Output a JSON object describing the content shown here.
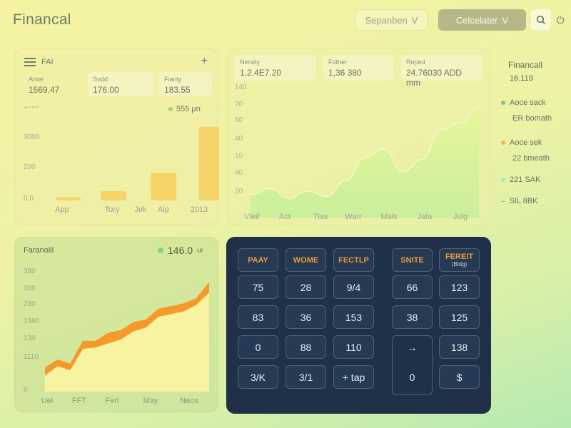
{
  "header": {
    "app_title": "Financal",
    "month_select": "Sepanben",
    "calculator_button": "Celcelater",
    "chevron": "V"
  },
  "left_card": {
    "title": "FAI",
    "add_symbol": "+",
    "stats": [
      {
        "label": "Anoe",
        "value": "1569,47"
      },
      {
        "label": "Sodd",
        "value": "176.00"
      },
      {
        "label": "Fianty",
        "value": "183.55"
      }
    ],
    "legend_value": "555 µn",
    "y_ticks": [
      "1000",
      "3000",
      "200",
      "0.0"
    ],
    "x_ticks": [
      "App",
      "Tory",
      "Jek",
      "Aip",
      "2013"
    ]
  },
  "middle_card": {
    "stats": [
      {
        "label": "Nersity",
        "value": "1.2.4E7.20"
      },
      {
        "label": "Fother",
        "value": "1,36 380"
      },
      {
        "label": "Reped",
        "value": "24.76030 ADD mm"
      }
    ],
    "y_ticks": [
      "140",
      "70",
      "50",
      "40",
      "10",
      "40",
      "20"
    ],
    "x_ticks": [
      "Vleif",
      "Act",
      "Tlas",
      "Warr",
      "Mais",
      "Jala",
      "Julg"
    ]
  },
  "side_panel": {
    "title": "Financall",
    "value": "16.119",
    "items": [
      {
        "label": "Aoce sack",
        "sub": "ER bomath",
        "color": "#7ec89a"
      },
      {
        "label": "Aoce sek",
        "sub": "22 bmeath",
        "color": "#f2b84a"
      },
      {
        "label": "221 SAK",
        "sub": "",
        "color": "#a8e8b8"
      },
      {
        "label": "SIL 8BK",
        "sub": "",
        "color": "#8fa8a0"
      }
    ]
  },
  "bottom_left_card": {
    "title": "Faranolil",
    "legend_value": "146.0",
    "legend_unit": "ur",
    "y_ticks": [
      "380",
      "350",
      "280",
      "1380",
      "130",
      "1110",
      "0"
    ],
    "x_ticks": [
      "Uel",
      "FFT",
      "Ferl",
      "May",
      "Neos"
    ]
  },
  "calculator": {
    "top_row": [
      "PAAY",
      "WOME",
      "FECTLP",
      "SNITE",
      "FEREIT"
    ],
    "top_row_sub": "(Bldg)",
    "rows": [
      [
        "75",
        "28",
        "9/4",
        "66",
        "123"
      ],
      [
        "83",
        "36",
        "153",
        "38",
        "125"
      ],
      [
        "0",
        "88",
        "110",
        "→",
        "138"
      ],
      [
        "3/K",
        "3/1",
        "+ tap",
        "0",
        "$"
      ]
    ]
  },
  "chart_data": [
    {
      "type": "bar",
      "title": "",
      "categories": [
        "App",
        "Tory",
        "Jek",
        "Aip",
        "2013"
      ],
      "values": [
        50,
        150,
        0,
        450,
        1200
      ],
      "ylim": [
        0,
        1300
      ],
      "colors": [
        "#f5cc55",
        "#f5cc55",
        "#f5cc55",
        "#f5cc55",
        "#f5cc55"
      ]
    },
    {
      "type": "area",
      "title": "",
      "x": [
        "Vleif",
        "Act",
        "Tlas",
        "Warr",
        "Mais",
        "Jala",
        "Julg"
      ],
      "values": [
        18,
        25,
        14,
        22,
        16,
        34,
        60,
        70,
        44,
        58,
        92,
        100,
        118
      ],
      "ylim": [
        0,
        140
      ]
    },
    {
      "type": "area",
      "title": "",
      "x": [
        "Uel",
        "FFT",
        "Ferl",
        "May",
        "Neos"
      ],
      "series": [
        {
          "values": [
            90,
            120,
            105,
            190,
            190,
            220,
            230,
            260,
            270,
            310,
            320,
            330,
            350,
            410
          ]
        },
        {
          "values": [
            60,
            95,
            80,
            160,
            165,
            180,
            195,
            225,
            240,
            280,
            290,
            300,
            325,
            370
          ]
        }
      ],
      "ylim": [
        0,
        400
      ],
      "colors": [
        "#f59a2a",
        "#f7f3a0"
      ]
    }
  ]
}
